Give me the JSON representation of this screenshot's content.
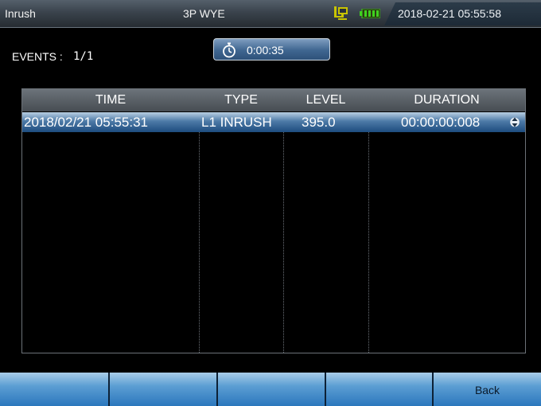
{
  "header": {
    "title": "Inrush",
    "mode": "3P WYE",
    "datetime": "2018-02-21 05:55:58",
    "network_icon": "network-icon",
    "battery_icon": "battery-icon"
  },
  "events": {
    "label": "EVENTS :",
    "value": "1/1"
  },
  "timer": {
    "icon": "stopwatch-icon",
    "value": "0:00:35"
  },
  "table": {
    "columns": [
      "TIME",
      "TYPE",
      "LEVEL",
      "DURATION"
    ],
    "rows": [
      {
        "time": "2018/02/21 05:55:31",
        "type": "L1 INRUSH",
        "level": "395.0",
        "duration": "00:00:00:008"
      }
    ],
    "selected_row": 0
  },
  "softkeys": [
    "",
    "",
    "",
    "",
    "Back"
  ],
  "colors": {
    "header": "#3a434c",
    "selection": "#2d5a8c",
    "softkey": "#4a92cf",
    "battery": "#3fd11f",
    "network": "#c9c400"
  }
}
